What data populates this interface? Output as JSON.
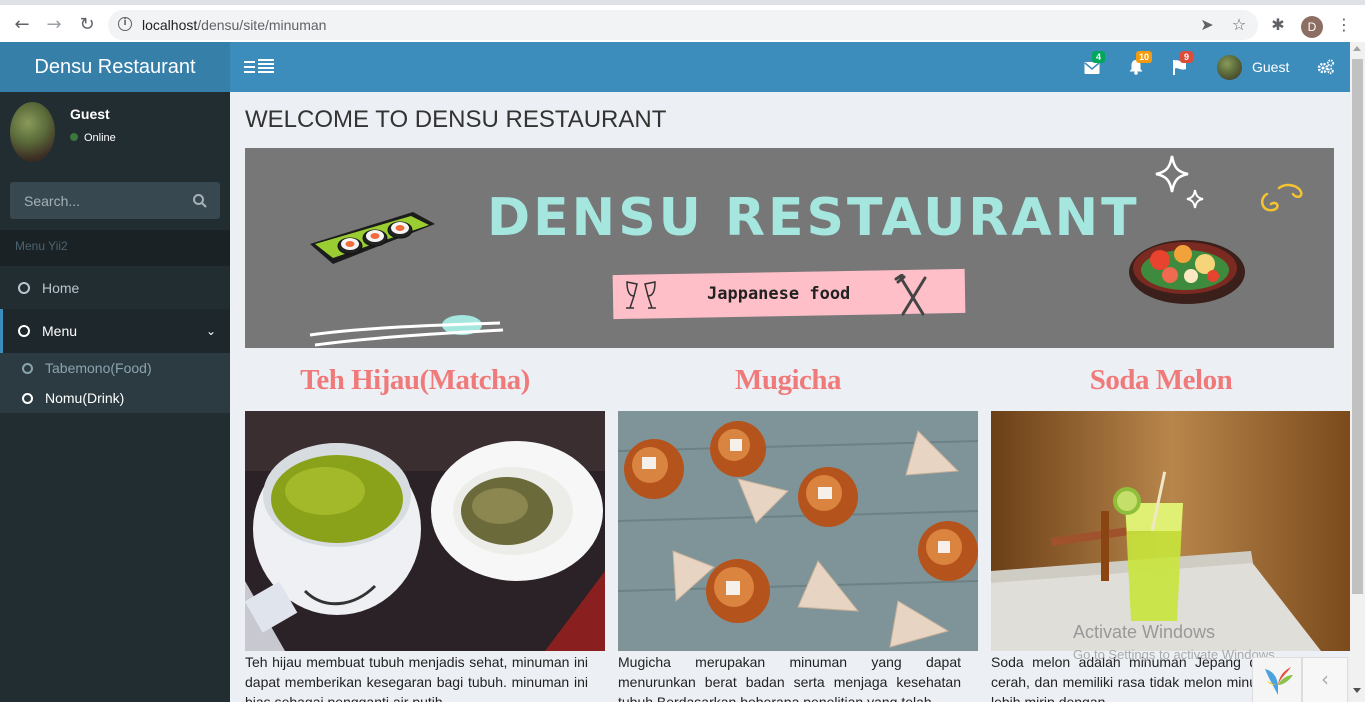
{
  "browser": {
    "url_host": "localhost",
    "url_path": "/densu/site/minuman",
    "profile_initial": "D"
  },
  "app": {
    "logo_text": "Densu Restaurant"
  },
  "sidebar": {
    "user_name": "Guest",
    "user_status": "Online",
    "search_placeholder": "Search...",
    "menu_header": "Menu Yii2",
    "items": [
      {
        "label": "Home",
        "icon": "circle-o-icon"
      },
      {
        "label": "Menu",
        "icon": "circle-o-icon",
        "expanded": true,
        "children": [
          {
            "label": "Tabemono(Food)"
          },
          {
            "label": "Nomu(Drink)"
          }
        ]
      }
    ]
  },
  "navbar": {
    "messages_count": "4",
    "notifications_count": "10",
    "tasks_count": "9",
    "user_name": "Guest",
    "colors": {
      "messages_badge": "#00a65a",
      "notifications_badge": "#f39c12",
      "tasks_badge": "#dd4b39"
    }
  },
  "main": {
    "title": "WELCOME TO DENSU RESTAURANT",
    "banner": {
      "title": "DENSU RESTAURANT",
      "subtitle": "Jappanese food"
    },
    "products": [
      {
        "name": "Teh Hijau(Matcha)",
        "desc": "Teh hijau membuat tubuh menjadis sehat, minuman ini dapat memberikan kesegaran bagi tubuh. minuman ini bias sebagai pengganti air putih"
      },
      {
        "name": "Mugicha",
        "desc": "Mugicha merupakan minuman yang dapat menurunkan berat badan serta menjaga kesehatan tubuh.Berdasarkan beberapa penelitian yang telah"
      },
      {
        "name": "Soda Melon",
        "desc": "Soda melon adalah minuman Jepang dengan hijau cerah, dan memiliki rasa tidak melon minuman satu ini lebih mirip dengan"
      }
    ]
  },
  "watermark": {
    "title": "Activate Windows",
    "subtitle": "Go to Settings to activate Windows."
  },
  "colors": {
    "navbar": "#3c8dbc",
    "logo_bg": "#367fa9",
    "sidebar": "#222d32",
    "content_bg": "#ecf0f5",
    "product_title": "#f07a7a"
  }
}
